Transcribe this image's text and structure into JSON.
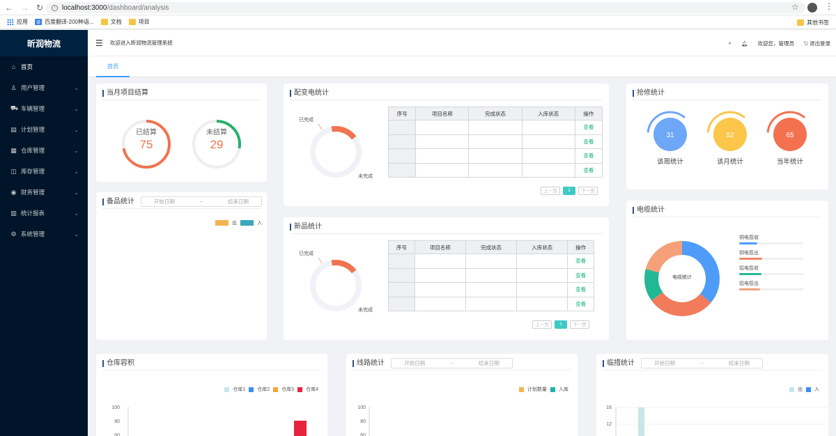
{
  "browser": {
    "url_host": "localhost:3000",
    "url_path": "/dashboard/analysis",
    "bookmarks": [
      {
        "label": "应用",
        "icon": "apps-grid-icon"
      },
      {
        "label": "百度翻译-200种语...",
        "icon": "translate-icon"
      },
      {
        "label": "文档",
        "icon": "folder-icon"
      },
      {
        "label": "项目",
        "icon": "folder-icon"
      }
    ],
    "other_bookmarks": "其他书签"
  },
  "sidebar": {
    "logo": "昕润物流",
    "items": [
      {
        "label": "首页",
        "icon": "home-icon",
        "glyph": "⌂",
        "has_arrow": false
      },
      {
        "label": "用户管理",
        "icon": "user-icon",
        "glyph": "♙",
        "has_arrow": true
      },
      {
        "label": "车辆管理",
        "icon": "vehicle-icon",
        "glyph": "⛟",
        "has_arrow": true
      },
      {
        "label": "计划管理",
        "icon": "document-icon",
        "glyph": "▤",
        "has_arrow": true
      },
      {
        "label": "仓库管理",
        "icon": "warehouse-icon",
        "glyph": "▦",
        "has_arrow": true
      },
      {
        "label": "库存管理",
        "icon": "inventory-icon",
        "glyph": "◫",
        "has_arrow": true
      },
      {
        "label": "财务管理",
        "icon": "finance-icon",
        "glyph": "◉",
        "has_arrow": true
      },
      {
        "label": "统计报表",
        "icon": "chart-icon",
        "glyph": "▥",
        "has_arrow": true
      },
      {
        "label": "系统管理",
        "icon": "settings-icon",
        "glyph": "⚙",
        "has_arrow": true
      }
    ]
  },
  "header": {
    "welcome": "欢迎进入昕润物流管理系统",
    "greeting": "欢迎您，管理员",
    "logout": "退出登录"
  },
  "tabs": [
    {
      "label": "首页"
    }
  ],
  "settlement": {
    "title": "当月项目结算",
    "settled_label": "已结算",
    "settled_value": "75",
    "unsettled_label": "未结算",
    "unsettled_value": "29",
    "settled_color": "#f0744f",
    "unsettled_color": "#28b06a"
  },
  "spare": {
    "title": "备品统计",
    "date_start": "开始日期",
    "date_sep": "~",
    "date_end": "结束日期",
    "legend": [
      {
        "name": "出",
        "color": "#f4b350"
      },
      {
        "name": "入",
        "color": "#3aa8b8"
      }
    ]
  },
  "power": {
    "title": "配变电统计",
    "done_label": "已完成",
    "undone_label": "未完成",
    "columns": [
      "序号",
      "项目名称",
      "完成状态",
      "入库状态",
      "操作"
    ],
    "rows": [
      {
        "idx": "",
        "name": "",
        "status": "",
        "stock": "",
        "op": "查看"
      },
      {
        "idx": "",
        "name": "",
        "status": "",
        "stock": "",
        "op": "查看"
      },
      {
        "idx": "",
        "name": "",
        "status": "",
        "stock": "",
        "op": "查看"
      },
      {
        "idx": "",
        "name": "",
        "status": "",
        "stock": "",
        "op": "查看"
      }
    ],
    "prev": "上一页",
    "page": "1",
    "next": "下一页"
  },
  "newitems": {
    "title": "新品统计",
    "done_label": "已完成",
    "undone_label": "未完成",
    "columns": [
      "序号",
      "项目名称",
      "完成状态",
      "入库状态",
      "操作"
    ],
    "rows": [
      {
        "idx": "",
        "name": "",
        "status": "",
        "stock": "",
        "op": "查看"
      },
      {
        "idx": "",
        "name": "",
        "status": "",
        "stock": "",
        "op": "查看"
      },
      {
        "idx": "",
        "name": "",
        "status": "",
        "stock": "",
        "op": "查看"
      },
      {
        "idx": "",
        "name": "",
        "status": "",
        "stock": "",
        "op": "查看"
      }
    ],
    "prev": "上一页",
    "page": "1",
    "next": "下一页"
  },
  "repair": {
    "title": "抢修统计",
    "items": [
      {
        "value": "31",
        "label": "该周统计",
        "color": "#6ea7f8"
      },
      {
        "value": "52",
        "label": "该月统计",
        "color": "#fbc64a"
      },
      {
        "value": "65",
        "label": "当年统计",
        "color": "#f4714f"
      }
    ]
  },
  "cable": {
    "title": "电缆统计",
    "center_label": "电缆统计",
    "legend": [
      {
        "name": "铜电揽收",
        "color": "#4e9cf8",
        "pct": 0.28
      },
      {
        "name": "铜电揽出",
        "color": "#f58466",
        "pct": 0.36
      },
      {
        "name": "铝电揽收",
        "color": "#22b894",
        "pct": 0.35
      },
      {
        "name": "铝电揽出",
        "color": "#f6a07a",
        "pct": 0.33
      }
    ],
    "slices": [
      {
        "name": "铜电揽收",
        "value": 36,
        "color": "#4e9cf8"
      },
      {
        "name": "铜电揽出",
        "value": 29,
        "color": "#f27b5c"
      },
      {
        "name": "铝电揽收",
        "value": 14,
        "color": "#22b894"
      },
      {
        "name": "铝电揽出",
        "value": 21,
        "color": "#f6a07a"
      }
    ]
  },
  "warehouse": {
    "title": "仓库容积",
    "legend": [
      {
        "name": "仓库1",
        "color": "#c7e6e8"
      },
      {
        "name": "仓库2",
        "color": "#3d8ef0"
      },
      {
        "name": "仓库3",
        "color": "#f5a53b"
      },
      {
        "name": "仓库4",
        "color": "#e8233f"
      }
    ],
    "ticks": [
      "100",
      "80",
      "60"
    ]
  },
  "route": {
    "title": "线路统计",
    "date_start": "开始日期",
    "date_sep": "~",
    "date_end": "结束日期",
    "legend": [
      {
        "name": "计划数量",
        "color": "#f4b350"
      },
      {
        "name": "入库",
        "color": "#20b2aa"
      }
    ],
    "ticks": [
      "100",
      "80",
      "60"
    ]
  },
  "temp": {
    "title": "临措统计",
    "date_start": "开始日期",
    "date_sep": "~",
    "date_end": "结束日期",
    "legend": [
      {
        "name": "出",
        "color": "#c7e6e8"
      },
      {
        "name": "入",
        "color": "#3d8ef0"
      }
    ],
    "ticks": [
      "16",
      "12"
    ]
  },
  "chart_data": [
    {
      "type": "pie",
      "title": "当月项目结算",
      "categories": [
        "已结算",
        "未结算"
      ],
      "values": [
        75,
        29
      ]
    },
    {
      "type": "pie",
      "title": "电缆统计",
      "categories": [
        "铜电揽收",
        "铜电揽出",
        "铝电揽收",
        "铝电揽出"
      ],
      "values": [
        36,
        29,
        14,
        21
      ]
    },
    {
      "type": "bar",
      "title": "仓库容积",
      "series": [
        {
          "name": "仓库4",
          "values": [
            80
          ]
        }
      ],
      "ylim": [
        0,
        100
      ]
    },
    {
      "type": "bar",
      "title": "临措统计",
      "series": [
        {
          "name": "出",
          "values": [
            16
          ]
        }
      ],
      "ylim": [
        0,
        16
      ]
    }
  ]
}
